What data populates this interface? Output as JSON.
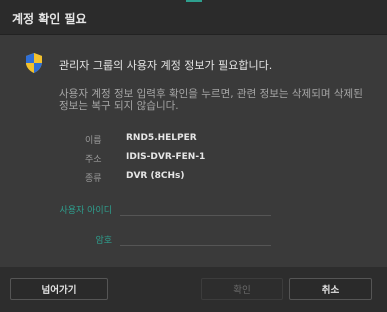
{
  "dialog": {
    "title": "계정 확인 필요",
    "heading": "관리자 그룹의 사용자 계정 정보가 필요합니다.",
    "description": "사용자 계정 정보 입력후 확인을 누르면, 관련 정보는 삭제되며 삭제된 정보는 복구 되지 않습니다."
  },
  "info": [
    {
      "label": "이름",
      "value": "RND5.HELPER"
    },
    {
      "label": "주소",
      "value": "IDIS-DVR-FEN-1"
    },
    {
      "label": "종류",
      "value": "DVR (8CHs)"
    }
  ],
  "form": {
    "user_id_label": "사용자 아이디",
    "user_id_value": "",
    "password_label": "암호",
    "password_value": ""
  },
  "buttons": {
    "skip": "넘어가기",
    "confirm": "확인",
    "cancel": "취소"
  },
  "colors": {
    "accent": "#2e9f8e",
    "background": "#3a3a3a",
    "titlebar": "#2b2b2b"
  },
  "icons": {
    "shield": "uac-shield-icon"
  }
}
